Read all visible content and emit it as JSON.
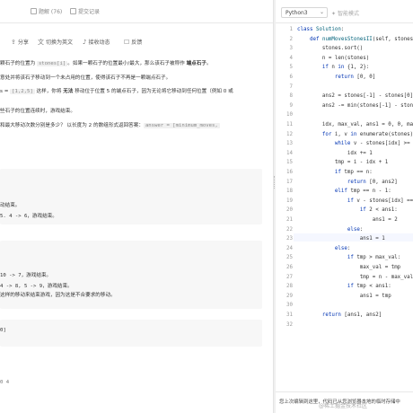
{
  "left": {
    "top_tabs": [
      {
        "label": "题解 (76)"
      },
      {
        "label": "提交记录"
      }
    ],
    "toolbar": [
      {
        "label": "分享"
      },
      {
        "label": "切换为英文"
      },
      {
        "label": "接收动态"
      },
      {
        "label": "反馈"
      }
    ],
    "text_lines": [
      {
        "a": "颗石子的位置为 ",
        "code": "stones[i]",
        "b": "。如果一颗石子的位置最小/最大，那么该石子被称作 ",
        "bold": "端点石子",
        "c": "。"
      },
      {
        "a": "意处并将该石子移动到一个未占用的位置，使得该石子不再是一颗端点石子。",
        "code": "",
        "b": "",
        "bold": "",
        "c": ""
      },
      {
        "a": "s = ",
        "code": "[1,2,5]",
        "b": " 这样，你将 ",
        "bold": "无法",
        "c": " 移动位于位置 5 的端点石子，因为无论将它移动到任何位置（例如 0 或"
      },
      {
        "a": "些石子的位置连续时，游戏结束。",
        "code": "",
        "b": "",
        "bold": "",
        "c": ""
      },
      {
        "a": "和最大移动次数分别是多少？ 以长度为 2 的数组形式返回答案：",
        "code": "answer = [minimum_moves,",
        "b": "",
        "bold": "",
        "c": ""
      }
    ],
    "example_boxes": [
      {
        "lines": [
          "动结束。",
          "5. 4 -> 6，游戏结束。"
        ]
      },
      {
        "lines": [
          "10 -> 7，游戏结束。",
          "4 -> 8, 5 -> 9，游戏结束。",
          "这样的移动来结束游戏，因为这是不合要求的移动。"
        ]
      },
      {
        "lines": [
          "0]"
        ]
      }
    ],
    "bottom_text": "0 4"
  },
  "editor": {
    "language": "Python3",
    "mode_label": "智能模式",
    "lines": [
      "class Solution:",
      "    def numMovesStonesII(self, stones:",
      "        stones.sort()",
      "        n = len(stones)",
      "        if n in {1, 2}:",
      "            return [0, 0]",
      "",
      "        ans2 = stones[-1] - stones[0]",
      "        ans2 -= min(stones[-1] - stone",
      "",
      "        idx, max_val, ans1 = 0, 0, mat",
      "        for i, v in enumerate(stones):",
      "            while v - stones[idx] >= n",
      "                idx += 1",
      "            tmp = i - idx + 1",
      "            if tmp == n:",
      "                return [0, ans2]",
      "            elif tmp == n - 1:",
      "                if v - stones[idx] ==",
      "                    if 2 < ans1:",
      "                        ans1 = 2",
      "                else:",
      "                    ans1 = 1",
      "            else:",
      "                if tmp > max_val:",
      "                    max_val = tmp",
      "                    tmp = n - max_val",
      "                if tmp < ans1:",
      "                    ans1 = tmp",
      "",
      "        return [ans1, ans2]",
      ""
    ],
    "status_text": "您上次编辑到这里，代码已从您浏览器本地的临时存储中",
    "watermark": "@稀土掘金技术社区"
  }
}
